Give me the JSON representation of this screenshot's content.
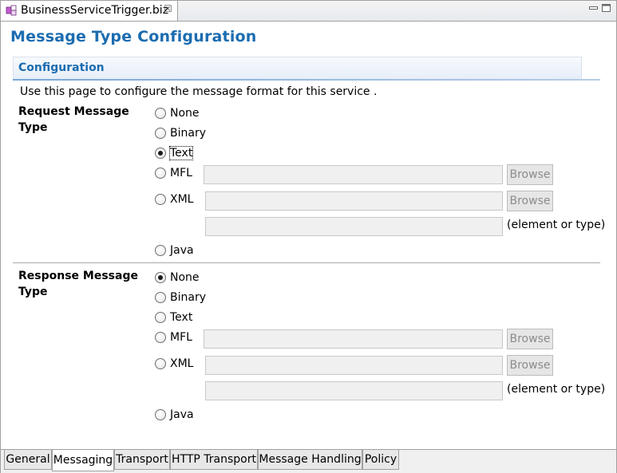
{
  "editor_tab": {
    "file_name": "BusinessServiceTrigger.biz",
    "close_glyph": "☒"
  },
  "page_title": "Message Type Configuration",
  "section": {
    "title": "Configuration",
    "description": "Use this page to configure the message format for this service ."
  },
  "request": {
    "label": "Request Message Type",
    "selected": "Text",
    "options": [
      "None",
      "Binary",
      "Text",
      "MFL",
      "XML",
      "Java"
    ]
  },
  "response": {
    "label": "Response Message Type",
    "selected": "None",
    "options": [
      "None",
      "Binary",
      "Text",
      "MFL",
      "XML",
      "Java"
    ]
  },
  "labels": {
    "browse": "Browse",
    "element_or_type": "(element or type)"
  },
  "page_tabs": {
    "active": "Messaging",
    "items": [
      "General",
      "Messaging",
      "Transport",
      "HTTP Transport",
      "Message Handling",
      "Policy"
    ]
  }
}
